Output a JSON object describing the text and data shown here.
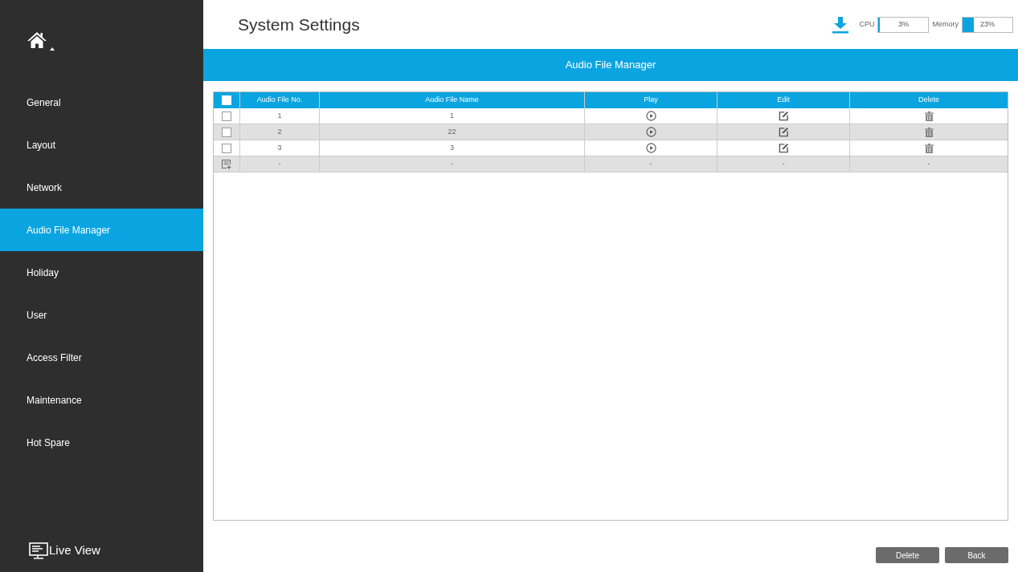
{
  "page_title": "System Settings",
  "sidebar": {
    "items": [
      {
        "label": "General",
        "selected": false
      },
      {
        "label": "Layout",
        "selected": false
      },
      {
        "label": "Network",
        "selected": false
      },
      {
        "label": "Audio File Manager",
        "selected": true
      },
      {
        "label": "Holiday",
        "selected": false
      },
      {
        "label": "User",
        "selected": false
      },
      {
        "label": "Access Filter",
        "selected": false
      },
      {
        "label": "Maintenance",
        "selected": false
      },
      {
        "label": "Hot Spare",
        "selected": false
      }
    ],
    "footer_link": "Live View"
  },
  "meters": [
    {
      "label": "CPU",
      "level": 0.03,
      "reading": "3%"
    },
    {
      "label": "Memory",
      "level": 0.23,
      "reading": "23%"
    }
  ],
  "section_title": "Audio File Manager",
  "table": {
    "select_all_checked": false,
    "columns": [
      "Audio File No.",
      "Audio File Name",
      "Play",
      "Edit",
      "Delete"
    ],
    "rows": [
      {
        "kind": "file",
        "checked": false,
        "number": "1",
        "name": "1"
      },
      {
        "kind": "file",
        "checked": false,
        "number": "2",
        "name": "22"
      },
      {
        "kind": "file",
        "checked": false,
        "number": "3",
        "name": "3"
      },
      {
        "kind": "add",
        "cells": [
          "-",
          "-",
          "-",
          "-",
          "-"
        ]
      }
    ]
  },
  "buttons": [
    "Delete",
    "Back"
  ]
}
